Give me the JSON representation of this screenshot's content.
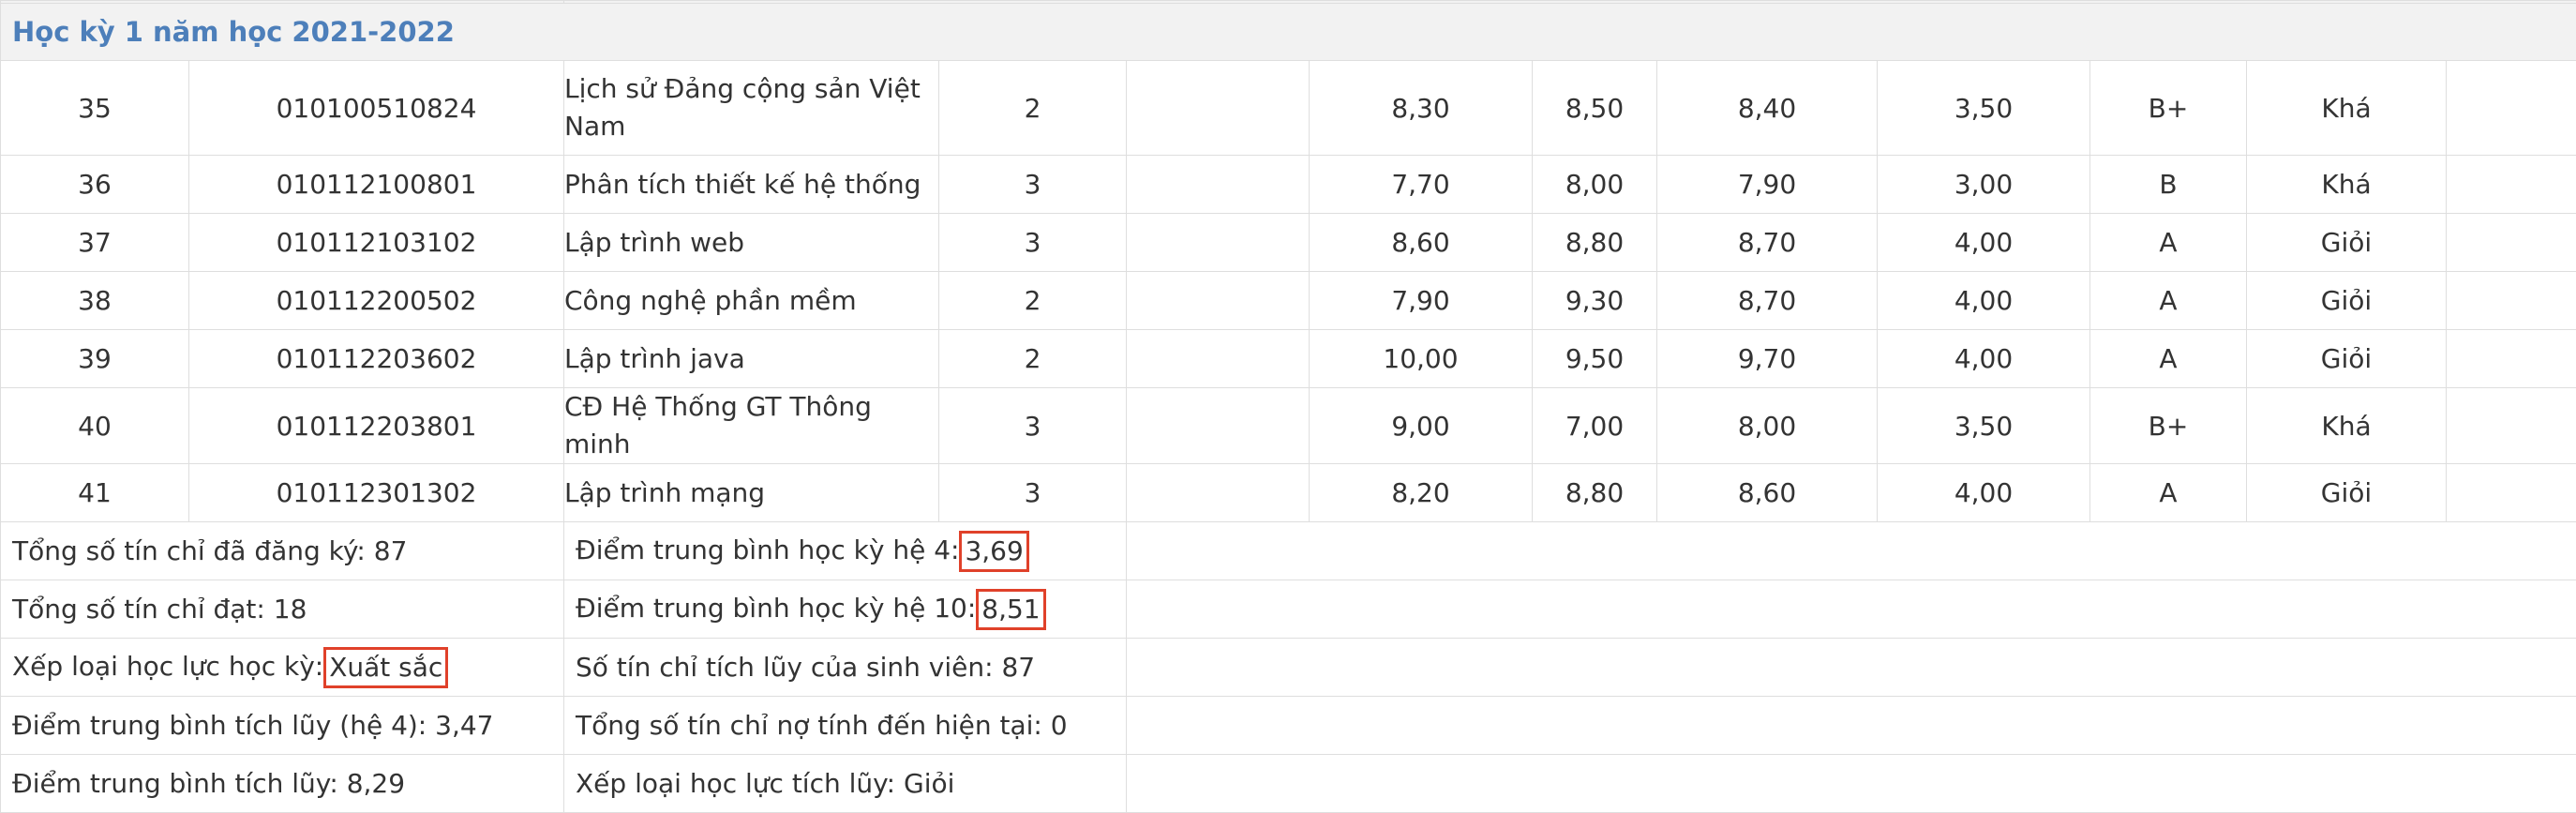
{
  "semester_title": "Học kỳ 1 năm học 2021-2022",
  "courses": [
    {
      "stt": "35",
      "code": "010100510824",
      "name": "Lịch sử Đảng cộng sản Việt Nam",
      "credits": "2",
      "blank": "",
      "score_a": "8,30",
      "score_b": "8,50",
      "score_10": "8,40",
      "score_4": "3,50",
      "letter": "B+",
      "rank": "Khá"
    },
    {
      "stt": "36",
      "code": "010112100801",
      "name": "Phân tích thiết kế hệ thống",
      "credits": "3",
      "blank": "",
      "score_a": "7,70",
      "score_b": "8,00",
      "score_10": "7,90",
      "score_4": "3,00",
      "letter": "B",
      "rank": "Khá"
    },
    {
      "stt": "37",
      "code": "010112103102",
      "name": "Lập trình web",
      "credits": "3",
      "blank": "",
      "score_a": "8,60",
      "score_b": "8,80",
      "score_10": "8,70",
      "score_4": "4,00",
      "letter": "A",
      "rank": "Giỏi"
    },
    {
      "stt": "38",
      "code": "010112200502",
      "name": "Công nghệ phần mềm",
      "credits": "2",
      "blank": "",
      "score_a": "7,90",
      "score_b": "9,30",
      "score_10": "8,70",
      "score_4": "4,00",
      "letter": "A",
      "rank": "Giỏi"
    },
    {
      "stt": "39",
      "code": "010112203602",
      "name": "Lập trình java",
      "credits": "2",
      "blank": "",
      "score_a": "10,00",
      "score_b": "9,50",
      "score_10": "9,70",
      "score_4": "4,00",
      "letter": "A",
      "rank": "Giỏi"
    },
    {
      "stt": "40",
      "code": "010112203801",
      "name": "CĐ Hệ Thống GT Thông minh",
      "credits": "3",
      "blank": "",
      "score_a": "9,00",
      "score_b": "7,00",
      "score_10": "8,00",
      "score_4": "3,50",
      "letter": "B+",
      "rank": "Khá"
    },
    {
      "stt": "41",
      "code": "010112301302",
      "name": "Lập trình mạng",
      "credits": "3",
      "blank": "",
      "score_a": "8,20",
      "score_b": "8,80",
      "score_10": "8,60",
      "score_4": "4,00",
      "letter": "A",
      "rank": "Giỏi"
    }
  ],
  "summary": {
    "registered_label": "Tổng số tín chỉ đã đăng ký:",
    "registered_value": "87",
    "gpa4_label": "Điểm trung bình học kỳ hệ 4:",
    "gpa4_value": "3,69",
    "passed_label": "Tổng số tín chỉ đạt:",
    "passed_value": "18",
    "gpa10_label": "Điểm trung bình học kỳ hệ 10:",
    "gpa10_value": "8,51",
    "semester_rank_label": "Xếp loại học lực học kỳ:",
    "semester_rank_value": "Xuất sắc",
    "accum_credits_label": "Số tín chỉ tích lũy của sinh viên:",
    "accum_credits_value": "87",
    "cum_gpa4_label": "Điểm trung bình tích lũy (hệ 4):",
    "cum_gpa4_value": "3,47",
    "debt_label": "Tổng số tín chỉ nợ tính đến hiện tại:",
    "debt_value": "0",
    "cum_gpa10_label": "Điểm trung bình tích lũy:",
    "cum_gpa10_value": "8,29",
    "cum_rank_label": "Xếp loại học lực tích lũy:",
    "cum_rank_value": "Giỏi"
  },
  "colors": {
    "header_text": "#4d7fba",
    "header_bg": "#f2f2f2",
    "border": "#dedede",
    "highlight_box": "#e0412a"
  }
}
